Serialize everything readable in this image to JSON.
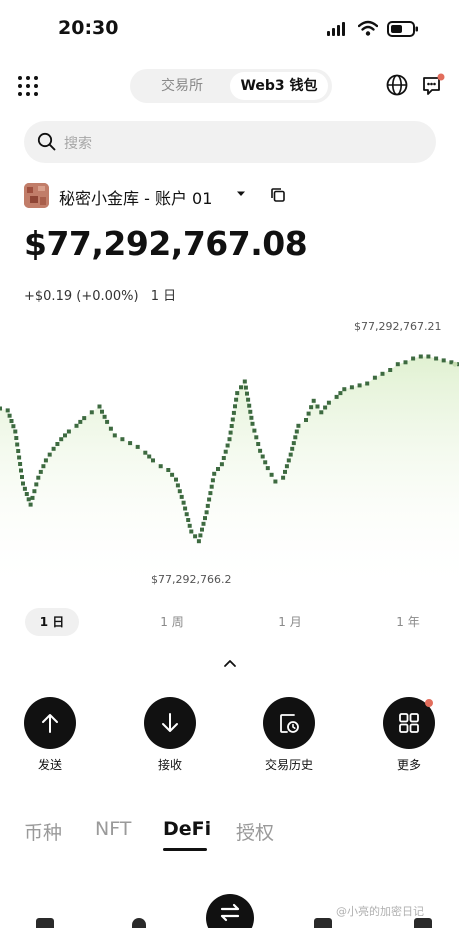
{
  "status_bar": {
    "time": "20:30",
    "icons": [
      "signal-icon",
      "wifi-icon",
      "battery-icon"
    ]
  },
  "header": {
    "menu_icon": "grid-menu-icon",
    "tabs": [
      {
        "label": "交易所",
        "active": false
      },
      {
        "label": "Web3 钱包",
        "active": true
      }
    ],
    "right_icons": [
      "globe-icon",
      "message-icon"
    ]
  },
  "search": {
    "placeholder": "搜索",
    "icon": "search-icon"
  },
  "account": {
    "name": "秘密小金库 - 账户 01",
    "icons": [
      "avatar",
      "dropdown-icon",
      "copy-icon"
    ]
  },
  "balance": {
    "amount": "$77,292,767.08",
    "change": "+$0.19 (+0.00%)",
    "period": "1 日"
  },
  "chart_data": {
    "type": "area",
    "title": "",
    "xlabel": "",
    "ylabel": "",
    "high_label": "$77,292,767.21",
    "low_label": "$77,292,766.2",
    "line_color": "#c5ddb0",
    "marker_color": "#3d6a40",
    "y": [
      766.94,
      766.93,
      766.82,
      766.55,
      766.44,
      766.58,
      766.67,
      766.73,
      766.78,
      766.82,
      766.85,
      766.89,
      766.92,
      766.95,
      766.87,
      766.8,
      766.78,
      766.76,
      766.74,
      766.71,
      766.67,
      766.64,
      766.62,
      766.57,
      766.45,
      766.3,
      766.25,
      766.4,
      766.6,
      766.65,
      766.78,
      767.02,
      767.08,
      766.86,
      766.72,
      766.63,
      766.56,
      766.58,
      766.7,
      766.85,
      766.88,
      766.98,
      766.92,
      766.97,
      767.0,
      767.04,
      767.05,
      767.06,
      767.07,
      767.1,
      767.12,
      767.14,
      767.17,
      767.18,
      767.2,
      767.21,
      767.21,
      767.2,
      767.19,
      767.18,
      767.17
    ],
    "ylim": [
      766.1,
      767.4
    ]
  },
  "range_tabs": [
    {
      "label": "1 日",
      "active": true
    },
    {
      "label": "1 周",
      "active": false
    },
    {
      "label": "1 月",
      "active": false
    },
    {
      "label": "1 年",
      "active": false
    }
  ],
  "actions": [
    {
      "label": "发送",
      "icon": "arrow-up-icon"
    },
    {
      "label": "接收",
      "icon": "arrow-down-icon"
    },
    {
      "label": "交易历史",
      "icon": "history-icon"
    },
    {
      "label": "更多",
      "icon": "apps-icon"
    }
  ],
  "asset_tabs": [
    {
      "label": "币种",
      "active": false
    },
    {
      "label": "NFT",
      "active": false
    },
    {
      "label": "DeFi",
      "active": true
    },
    {
      "label": "授权",
      "active": false
    }
  ],
  "bottom_nav": {
    "center_icon": "swap-icon"
  },
  "watermark": "@小亮的加密日记"
}
